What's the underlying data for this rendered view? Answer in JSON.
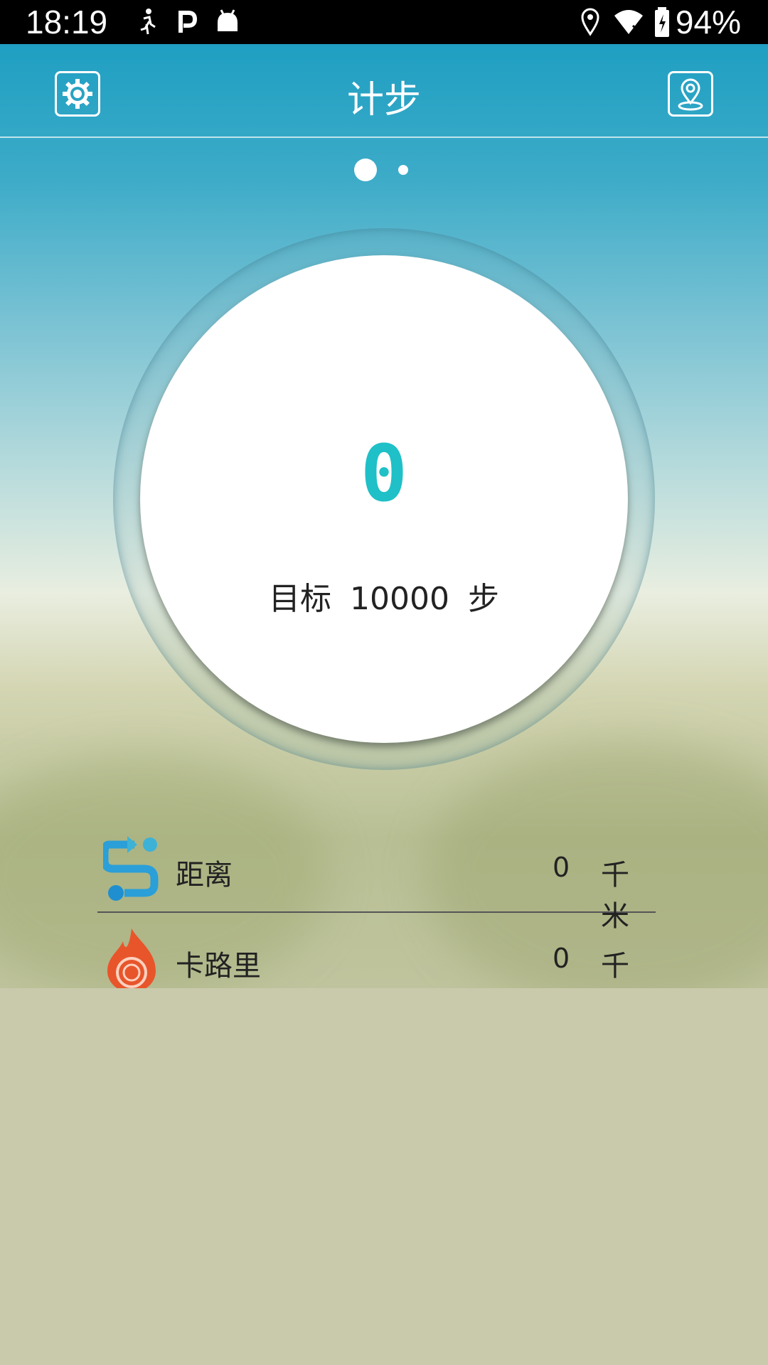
{
  "status_bar": {
    "time": "18:19",
    "battery_percent": "94%",
    "icons": [
      "running-person-icon",
      "parking-p-icon",
      "android-icon",
      "location-pin-icon",
      "wifi-icon",
      "battery-charging-icon"
    ]
  },
  "header": {
    "title": "计步",
    "left_icon": "settings-gear-icon",
    "right_icon": "location-marker-icon"
  },
  "pager": {
    "pages": 2,
    "active": 0
  },
  "counter": {
    "steps": "0",
    "goal_label": "目标",
    "goal_value": "10000",
    "goal_unit": "步"
  },
  "stats": [
    {
      "icon": "distance-route-icon",
      "label": "距离",
      "value": "0",
      "unit": "千米"
    },
    {
      "icon": "flame-calorie-icon",
      "label": "卡路里",
      "value": "0",
      "unit": "千卡"
    }
  ],
  "colors": {
    "accent": "#1fc0c7",
    "header_blue": "#1f9fc2",
    "bottom_bg": "#c9caab",
    "distance_icon": "#2a9fd8",
    "calorie_icon": "#e8552b"
  }
}
